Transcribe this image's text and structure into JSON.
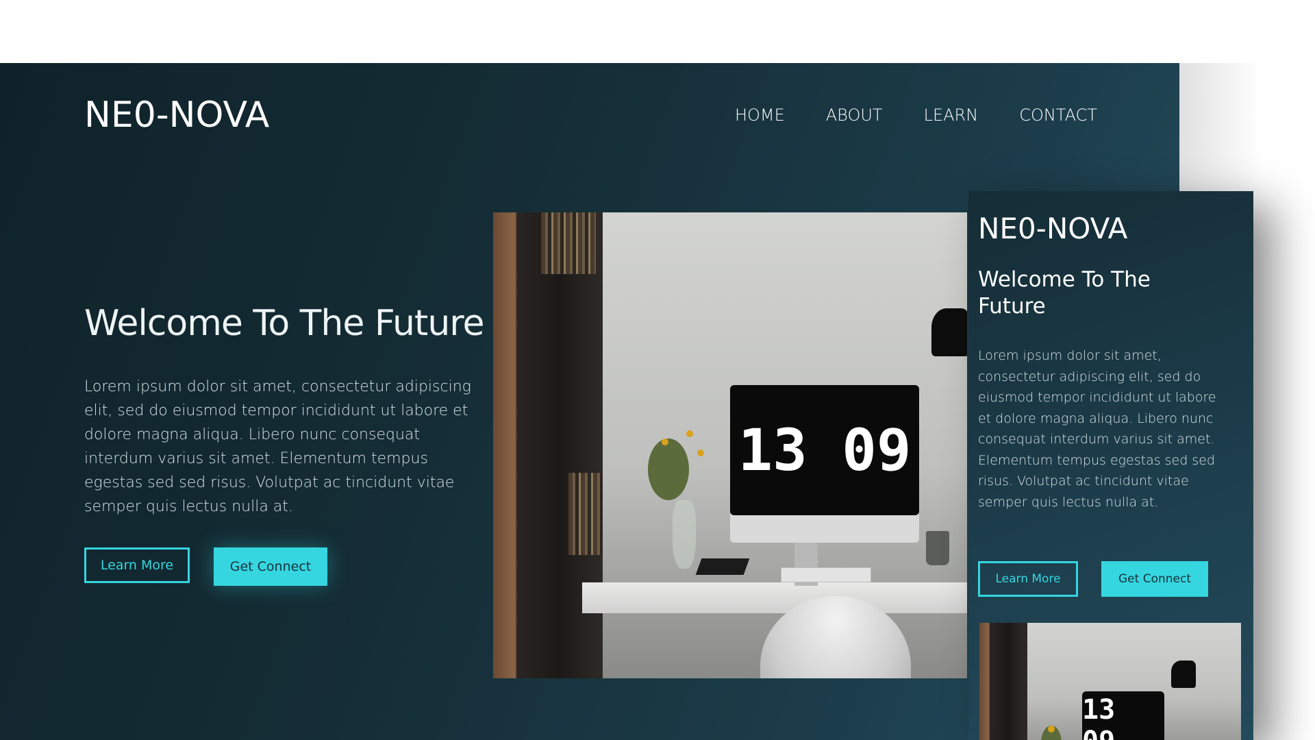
{
  "desktop": {
    "logo": "NE0-NOVA",
    "nav": [
      "HOME",
      "ABOUT",
      "LEARN",
      "CONTACT"
    ],
    "hero": {
      "title": "Welcome To The Future",
      "text": "Lorem ipsum dolor sit amet, consectetur adipiscing elit, sed do eiusmod tempor incididunt ut labore et dolore magna aliqua. Libero nunc consequat interdum varius sit amet. Elementum tempus egestas sed sed risus. Volutpat ac tincidunt vitae semper quis lectus nulla at.",
      "learn_more": "Learn More",
      "get_connect": "Get Connect"
    },
    "photo_clock": "13 09"
  },
  "mobile": {
    "logo": "NE0-NOVA",
    "title": "Welcome To The Future",
    "text": "Lorem ipsum dolor sit amet, consectetur adipiscing elit, sed do eiusmod tempor incididunt ut labore et dolore magna aliqua. Libero nunc consequat interdum varius sit amet. Elementum tempus egestas sed sed risus. Volutpat ac tincidunt vitae semper quis lectus nulla at.",
    "learn_more": "Learn More",
    "get_connect": "Get Connect",
    "photo_clock": "13 09"
  },
  "colors": {
    "accent": "#35d6e0",
    "background_dark": "#0f2229",
    "background_light": "#274f61"
  }
}
